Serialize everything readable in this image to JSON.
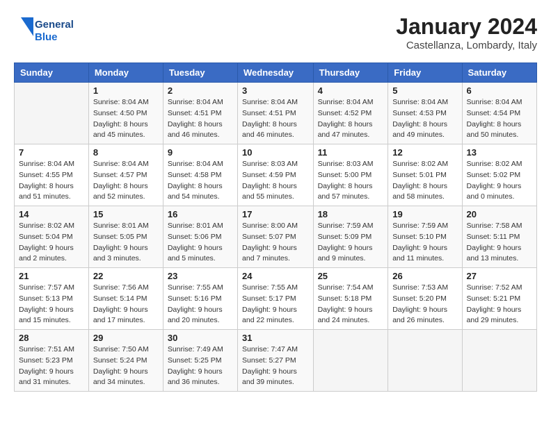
{
  "header": {
    "logo_general": "General",
    "logo_blue": "Blue",
    "month_year": "January 2024",
    "location": "Castellanza, Lombardy, Italy"
  },
  "weekdays": [
    "Sunday",
    "Monday",
    "Tuesday",
    "Wednesday",
    "Thursday",
    "Friday",
    "Saturday"
  ],
  "weeks": [
    [
      {
        "day": "",
        "sunrise": "",
        "sunset": "",
        "daylight": ""
      },
      {
        "day": "1",
        "sunrise": "Sunrise: 8:04 AM",
        "sunset": "Sunset: 4:50 PM",
        "daylight": "Daylight: 8 hours and 45 minutes."
      },
      {
        "day": "2",
        "sunrise": "Sunrise: 8:04 AM",
        "sunset": "Sunset: 4:51 PM",
        "daylight": "Daylight: 8 hours and 46 minutes."
      },
      {
        "day": "3",
        "sunrise": "Sunrise: 8:04 AM",
        "sunset": "Sunset: 4:51 PM",
        "daylight": "Daylight: 8 hours and 46 minutes."
      },
      {
        "day": "4",
        "sunrise": "Sunrise: 8:04 AM",
        "sunset": "Sunset: 4:52 PM",
        "daylight": "Daylight: 8 hours and 47 minutes."
      },
      {
        "day": "5",
        "sunrise": "Sunrise: 8:04 AM",
        "sunset": "Sunset: 4:53 PM",
        "daylight": "Daylight: 8 hours and 49 minutes."
      },
      {
        "day": "6",
        "sunrise": "Sunrise: 8:04 AM",
        "sunset": "Sunset: 4:54 PM",
        "daylight": "Daylight: 8 hours and 50 minutes."
      }
    ],
    [
      {
        "day": "7",
        "sunrise": "Sunrise: 8:04 AM",
        "sunset": "Sunset: 4:55 PM",
        "daylight": "Daylight: 8 hours and 51 minutes."
      },
      {
        "day": "8",
        "sunrise": "Sunrise: 8:04 AM",
        "sunset": "Sunset: 4:57 PM",
        "daylight": "Daylight: 8 hours and 52 minutes."
      },
      {
        "day": "9",
        "sunrise": "Sunrise: 8:04 AM",
        "sunset": "Sunset: 4:58 PM",
        "daylight": "Daylight: 8 hours and 54 minutes."
      },
      {
        "day": "10",
        "sunrise": "Sunrise: 8:03 AM",
        "sunset": "Sunset: 4:59 PM",
        "daylight": "Daylight: 8 hours and 55 minutes."
      },
      {
        "day": "11",
        "sunrise": "Sunrise: 8:03 AM",
        "sunset": "Sunset: 5:00 PM",
        "daylight": "Daylight: 8 hours and 57 minutes."
      },
      {
        "day": "12",
        "sunrise": "Sunrise: 8:02 AM",
        "sunset": "Sunset: 5:01 PM",
        "daylight": "Daylight: 8 hours and 58 minutes."
      },
      {
        "day": "13",
        "sunrise": "Sunrise: 8:02 AM",
        "sunset": "Sunset: 5:02 PM",
        "daylight": "Daylight: 9 hours and 0 minutes."
      }
    ],
    [
      {
        "day": "14",
        "sunrise": "Sunrise: 8:02 AM",
        "sunset": "Sunset: 5:04 PM",
        "daylight": "Daylight: 9 hours and 2 minutes."
      },
      {
        "day": "15",
        "sunrise": "Sunrise: 8:01 AM",
        "sunset": "Sunset: 5:05 PM",
        "daylight": "Daylight: 9 hours and 3 minutes."
      },
      {
        "day": "16",
        "sunrise": "Sunrise: 8:01 AM",
        "sunset": "Sunset: 5:06 PM",
        "daylight": "Daylight: 9 hours and 5 minutes."
      },
      {
        "day": "17",
        "sunrise": "Sunrise: 8:00 AM",
        "sunset": "Sunset: 5:07 PM",
        "daylight": "Daylight: 9 hours and 7 minutes."
      },
      {
        "day": "18",
        "sunrise": "Sunrise: 7:59 AM",
        "sunset": "Sunset: 5:09 PM",
        "daylight": "Daylight: 9 hours and 9 minutes."
      },
      {
        "day": "19",
        "sunrise": "Sunrise: 7:59 AM",
        "sunset": "Sunset: 5:10 PM",
        "daylight": "Daylight: 9 hours and 11 minutes."
      },
      {
        "day": "20",
        "sunrise": "Sunrise: 7:58 AM",
        "sunset": "Sunset: 5:11 PM",
        "daylight": "Daylight: 9 hours and 13 minutes."
      }
    ],
    [
      {
        "day": "21",
        "sunrise": "Sunrise: 7:57 AM",
        "sunset": "Sunset: 5:13 PM",
        "daylight": "Daylight: 9 hours and 15 minutes."
      },
      {
        "day": "22",
        "sunrise": "Sunrise: 7:56 AM",
        "sunset": "Sunset: 5:14 PM",
        "daylight": "Daylight: 9 hours and 17 minutes."
      },
      {
        "day": "23",
        "sunrise": "Sunrise: 7:55 AM",
        "sunset": "Sunset: 5:16 PM",
        "daylight": "Daylight: 9 hours and 20 minutes."
      },
      {
        "day": "24",
        "sunrise": "Sunrise: 7:55 AM",
        "sunset": "Sunset: 5:17 PM",
        "daylight": "Daylight: 9 hours and 22 minutes."
      },
      {
        "day": "25",
        "sunrise": "Sunrise: 7:54 AM",
        "sunset": "Sunset: 5:18 PM",
        "daylight": "Daylight: 9 hours and 24 minutes."
      },
      {
        "day": "26",
        "sunrise": "Sunrise: 7:53 AM",
        "sunset": "Sunset: 5:20 PM",
        "daylight": "Daylight: 9 hours and 26 minutes."
      },
      {
        "day": "27",
        "sunrise": "Sunrise: 7:52 AM",
        "sunset": "Sunset: 5:21 PM",
        "daylight": "Daylight: 9 hours and 29 minutes."
      }
    ],
    [
      {
        "day": "28",
        "sunrise": "Sunrise: 7:51 AM",
        "sunset": "Sunset: 5:23 PM",
        "daylight": "Daylight: 9 hours and 31 minutes."
      },
      {
        "day": "29",
        "sunrise": "Sunrise: 7:50 AM",
        "sunset": "Sunset: 5:24 PM",
        "daylight": "Daylight: 9 hours and 34 minutes."
      },
      {
        "day": "30",
        "sunrise": "Sunrise: 7:49 AM",
        "sunset": "Sunset: 5:25 PM",
        "daylight": "Daylight: 9 hours and 36 minutes."
      },
      {
        "day": "31",
        "sunrise": "Sunrise: 7:47 AM",
        "sunset": "Sunset: 5:27 PM",
        "daylight": "Daylight: 9 hours and 39 minutes."
      },
      {
        "day": "",
        "sunrise": "",
        "sunset": "",
        "daylight": ""
      },
      {
        "day": "",
        "sunrise": "",
        "sunset": "",
        "daylight": ""
      },
      {
        "day": "",
        "sunrise": "",
        "sunset": "",
        "daylight": ""
      }
    ]
  ]
}
